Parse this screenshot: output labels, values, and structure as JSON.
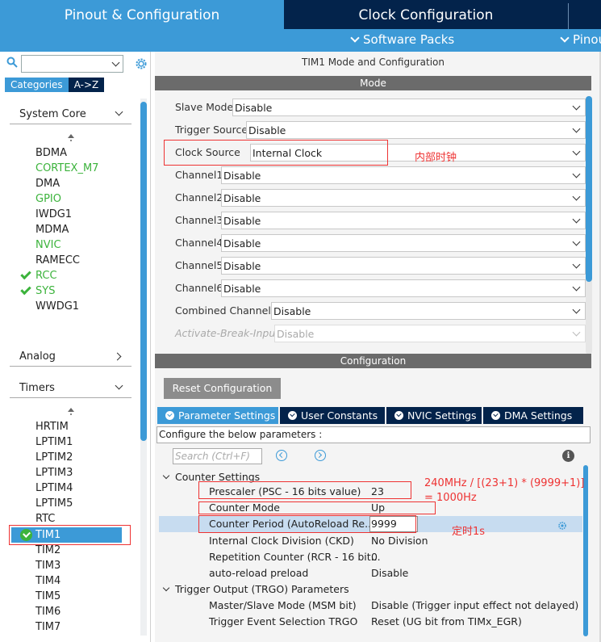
{
  "tabs": {
    "pinout": "Pinout & Configuration",
    "clock": "Clock Configuration"
  },
  "subbar": {
    "software_packs": "Software Packs",
    "pinout": "Pinout"
  },
  "left": {
    "categories_tab": "Categories",
    "az_tab": "A->Z",
    "system_core": {
      "label": "System Core",
      "items": [
        "BDMA",
        "CORTEX_M7",
        "DMA",
        "GPIO",
        "IWDG1",
        "MDMA",
        "NVIC",
        "RAMECC",
        "RCC",
        "SYS",
        "WWDG1"
      ]
    },
    "analog": {
      "label": "Analog"
    },
    "timers": {
      "label": "Timers",
      "items": [
        "HRTIM",
        "LPTIM1",
        "LPTIM2",
        "LPTIM3",
        "LPTIM4",
        "LPTIM5",
        "RTC",
        "TIM1",
        "TIM2",
        "TIM3",
        "TIM4",
        "TIM5",
        "TIM6",
        "TIM7"
      ]
    }
  },
  "mode": {
    "window_title": "TIM1 Mode and Configuration",
    "header": "Mode",
    "rows": [
      {
        "label": "Slave Mode",
        "value": "Disable"
      },
      {
        "label": "Trigger Source",
        "value": "Disable"
      },
      {
        "label": "Clock Source",
        "value": "Internal Clock"
      },
      {
        "label": "Channel1",
        "value": "Disable"
      },
      {
        "label": "Channel2",
        "value": "Disable"
      },
      {
        "label": "Channel3",
        "value": "Disable"
      },
      {
        "label": "Channel4",
        "value": "Disable"
      },
      {
        "label": "Channel5",
        "value": "Disable"
      },
      {
        "label": "Channel6",
        "value": "Disable"
      },
      {
        "label": "Combined Channels",
        "value": "Disable"
      },
      {
        "label": "Activate-Break-Input",
        "value": "Disable"
      }
    ],
    "annotation": "内部时钟"
  },
  "config": {
    "header": "Configuration",
    "reset_button": "Reset Configuration",
    "tabs": [
      "Parameter Settings",
      "User Constants",
      "NVIC Settings",
      "DMA Settings"
    ],
    "description": "Configure the below parameters :",
    "search_placeholder": "Search (Ctrl+F)",
    "sections": [
      {
        "title": "Counter Settings",
        "params": [
          {
            "label": "Prescaler (PSC - 16 bits value)",
            "value": "23"
          },
          {
            "label": "Counter Mode",
            "value": "Up"
          },
          {
            "label": "Counter Period (AutoReload Re...",
            "value": "9999"
          },
          {
            "label": "Internal Clock Division (CKD)",
            "value": "No Division"
          },
          {
            "label": "Repetition Counter (RCR - 16 bit...",
            "value": "0"
          },
          {
            "label": "auto-reload preload",
            "value": "Disable"
          }
        ]
      },
      {
        "title": "Trigger Output (TRGO) Parameters",
        "params": [
          {
            "label": "Master/Slave Mode (MSM bit)",
            "value": "Disable (Trigger input effect not delayed)"
          },
          {
            "label": "Trigger Event Selection TRGO",
            "value": "Reset (UG bit from TIMx_EGR)"
          }
        ]
      }
    ],
    "annotation_formula_1": "240MHz / [(23+1) * (9999+1)]",
    "annotation_formula_2": "= 1000Hz",
    "annotation_timer": "定时1s"
  },
  "colors": {
    "accent": "#3c9ad7",
    "navy": "#03234b",
    "highlight_red": "#e33333",
    "green": "#3cb33c"
  }
}
